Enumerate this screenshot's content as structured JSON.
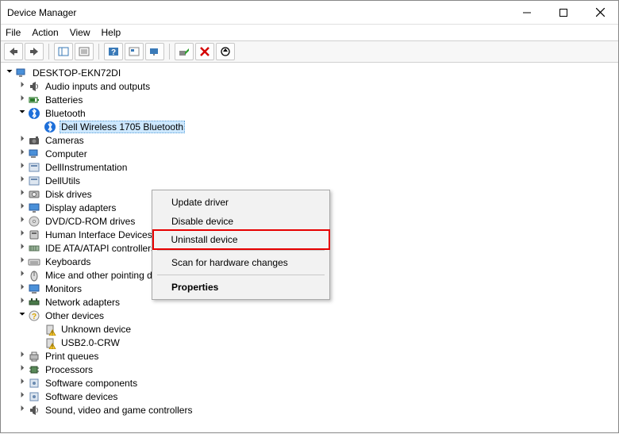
{
  "title": "Device Manager",
  "menu": {
    "file": "File",
    "action": "Action",
    "view": "View",
    "help": "Help"
  },
  "tree": {
    "root": "DESKTOP-EKN72DI",
    "items": [
      {
        "label": "Audio inputs and outputs",
        "icon": "audio",
        "arrow": "closed"
      },
      {
        "label": "Batteries",
        "icon": "battery",
        "arrow": "closed"
      },
      {
        "label": "Bluetooth",
        "icon": "bluetooth",
        "arrow": "open",
        "children": [
          {
            "label": "Dell Wireless 1705 Bluetooth",
            "icon": "bluetooth",
            "selected": true
          }
        ]
      },
      {
        "label": "Cameras",
        "icon": "camera",
        "arrow": "closed"
      },
      {
        "label": "Computer",
        "icon": "computer",
        "arrow": "closed"
      },
      {
        "label": "DellInstrumentation",
        "icon": "generic",
        "arrow": "closed"
      },
      {
        "label": "DellUtils",
        "icon": "generic",
        "arrow": "closed"
      },
      {
        "label": "Disk drives",
        "icon": "disk",
        "arrow": "closed"
      },
      {
        "label": "Display adapters",
        "icon": "display",
        "arrow": "closed"
      },
      {
        "label": "DVD/CD-ROM drives",
        "icon": "dvd",
        "arrow": "closed"
      },
      {
        "label": "Human Interface Devices",
        "icon": "hid",
        "arrow": "closed"
      },
      {
        "label": "IDE ATA/ATAPI controllers",
        "icon": "ide",
        "arrow": "closed"
      },
      {
        "label": "Keyboards",
        "icon": "keyboard",
        "arrow": "closed"
      },
      {
        "label": "Mice and other pointing devices",
        "icon": "mouse",
        "arrow": "closed"
      },
      {
        "label": "Monitors",
        "icon": "monitor",
        "arrow": "closed"
      },
      {
        "label": "Network adapters",
        "icon": "network",
        "arrow": "closed"
      },
      {
        "label": "Other devices",
        "icon": "other",
        "arrow": "open",
        "children": [
          {
            "label": "Unknown device",
            "icon": "warn"
          },
          {
            "label": "USB2.0-CRW",
            "icon": "warn"
          }
        ]
      },
      {
        "label": "Print queues",
        "icon": "printer",
        "arrow": "closed"
      },
      {
        "label": "Processors",
        "icon": "cpu",
        "arrow": "closed"
      },
      {
        "label": "Software components",
        "icon": "soft",
        "arrow": "closed"
      },
      {
        "label": "Software devices",
        "icon": "soft",
        "arrow": "closed"
      },
      {
        "label": "Sound, video and game controllers",
        "icon": "audio",
        "arrow": "closed"
      }
    ]
  },
  "context_menu": {
    "update": "Update driver",
    "disable": "Disable device",
    "uninstall": "Uninstall device",
    "scan": "Scan for hardware changes",
    "properties": "Properties"
  }
}
